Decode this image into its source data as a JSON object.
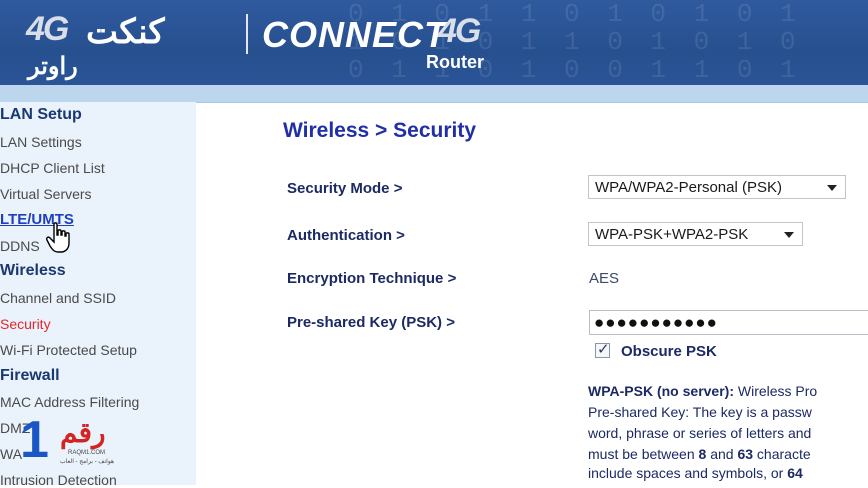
{
  "header": {
    "logo_4g": "4G",
    "logo_arabic": "كنكت",
    "logo_arabic_sub": "راوتر",
    "logo_connect": "CONNECT",
    "logo_4g_right": "4G",
    "logo_router": "Router"
  },
  "sidebar": {
    "sections": [
      {
        "heading": "LAN Setup",
        "items": [
          "LAN Settings",
          "DHCP Client List",
          "Virtual Servers"
        ]
      },
      {
        "heading": "LTE/UMTS",
        "items": [
          "DDNS"
        ]
      },
      {
        "heading": "Wireless",
        "items": [
          "Channel and SSID",
          "Security",
          "Wi-Fi Protected Setup"
        ]
      },
      {
        "heading": "Firewall",
        "items": [
          "MAC Address Filtering",
          "DMZ",
          "WA",
          "Intrusion Detection"
        ]
      }
    ],
    "active_item": "Security",
    "hovered_link": "LTE/UMTS",
    "active_color": "#e8262a"
  },
  "page": {
    "title": "Wireless > Security"
  },
  "form": {
    "security_mode": {
      "label": "Security Mode >",
      "value": "WPA/WPA2-Personal (PSK)"
    },
    "authentication": {
      "label": "Authentication >",
      "value": "WPA-PSK+WPA2-PSK"
    },
    "encryption": {
      "label": "Encryption Technique >",
      "value": "AES"
    },
    "psk": {
      "label": "Pre-shared Key (PSK) >",
      "value": "●●●●●●●●●●●"
    },
    "obscure": {
      "label": "Obscure PSK",
      "checked": true
    }
  },
  "description": {
    "heading": "WPA-PSK (no server):",
    "line1": " Wireless Pro",
    "line2": "Pre-shared Key: The key is a passw",
    "line3": "word, phrase or series of letters and",
    "line4_a": "must be between ",
    "line4_b": "8",
    "line4_c": " and ",
    "line4_d": "63",
    "line4_e": " characte",
    "line5_a": "include spaces and symbols, or ",
    "line5_b": "64"
  },
  "watermark": {
    "digit": "1",
    "arabic": "رقم",
    "domain": "RAQM1.COM",
    "tagline": "هواتف - برامج - العاب"
  }
}
